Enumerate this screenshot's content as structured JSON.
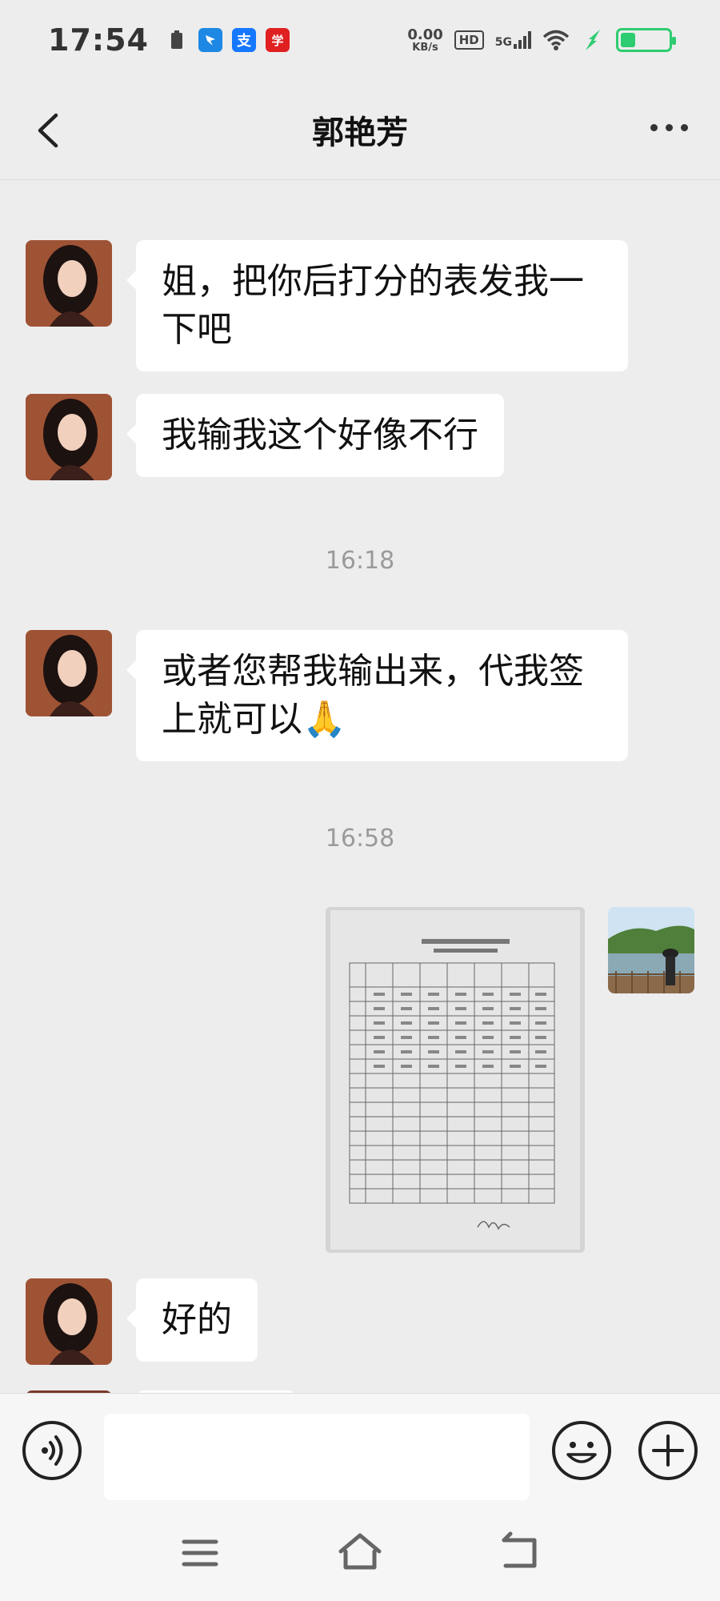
{
  "status_bar": {
    "time": "17:54",
    "net_speed_value": "0.00",
    "net_speed_unit": "KB/s",
    "hd_label": "HD",
    "signal_label": "5G",
    "app_icons": [
      "battery-saver-icon",
      "dingtalk-icon",
      "alipay-icon",
      "xuexi-icon"
    ],
    "alipay_glyph": "支",
    "xuexi_glyph": "学",
    "colors": {
      "battery": "#2ecc71"
    }
  },
  "header": {
    "title": "郭艳芳"
  },
  "chat": {
    "messages": [
      {
        "sender": "other",
        "text": "姐，把你后打分的表发我一下吧"
      },
      {
        "sender": "other",
        "text": "我输我这个好像不行"
      },
      {
        "type": "timestamp",
        "text": "16:18"
      },
      {
        "sender": "other",
        "text": "或者您帮我输出来，代我签上就可以",
        "emoji": "🙏"
      },
      {
        "type": "timestamp",
        "text": "16:58"
      },
      {
        "sender": "self",
        "type": "image"
      },
      {
        "sender": "other",
        "text": "好的"
      }
    ]
  },
  "input_bar": {
    "value": "",
    "placeholder": ""
  },
  "colors": {
    "background": "#ededed",
    "bubble": "#ffffff",
    "timestamp": "#9a9a9a"
  }
}
